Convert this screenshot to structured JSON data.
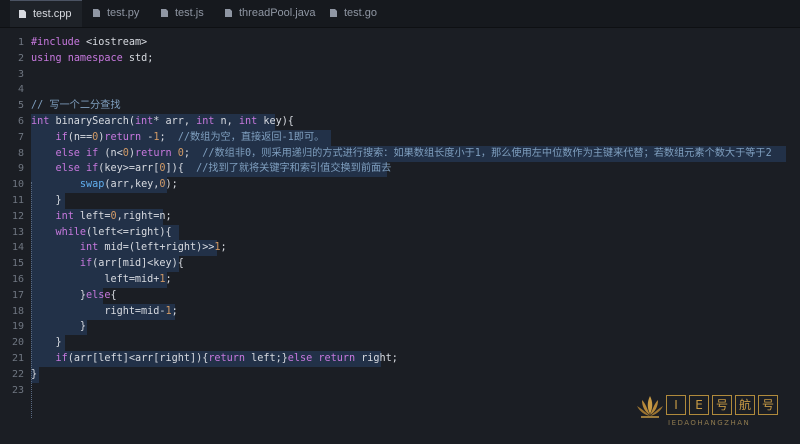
{
  "tabs": [
    {
      "label": "test.cpp",
      "active": true
    },
    {
      "label": "test.py",
      "active": false
    },
    {
      "label": "test.js",
      "active": false
    },
    {
      "label": "threadPool.java",
      "active": false
    },
    {
      "label": "test.go",
      "active": false
    }
  ],
  "colors": {
    "background": "#1b1e24",
    "keyword": "#c678dd",
    "number": "#d19a66",
    "comment": "#7f9fbf",
    "selection": "#223148"
  },
  "selected_lines": [
    6,
    22
  ],
  "code_lines": [
    {
      "n": "1",
      "tokens": [
        [
          "pp",
          "#include"
        ],
        [
          "pl",
          " <iostream>"
        ]
      ]
    },
    {
      "n": "2",
      "tokens": [
        [
          "kw",
          "using"
        ],
        [
          "pl",
          " "
        ],
        [
          "kw",
          "namespace"
        ],
        [
          "pl",
          " std;"
        ]
      ]
    },
    {
      "n": "3",
      "tokens": []
    },
    {
      "n": "4",
      "tokens": []
    },
    {
      "n": "5",
      "tokens": [
        [
          "cm",
          "// 写一个二分查找"
        ]
      ]
    },
    {
      "n": "6",
      "tokens": [
        [
          "ty",
          "int"
        ],
        [
          "pl",
          " binarySearch("
        ],
        [
          "ty",
          "int"
        ],
        [
          "pl",
          "* arr, "
        ],
        [
          "ty",
          "int"
        ],
        [
          "pl",
          " n, "
        ],
        [
          "ty",
          "int"
        ],
        [
          "pl",
          " key){"
        ]
      ]
    },
    {
      "n": "7",
      "tokens": [
        [
          "pl",
          "    "
        ],
        [
          "kw",
          "if"
        ],
        [
          "pl",
          "(n=="
        ],
        [
          "num",
          "0"
        ],
        [
          "pl",
          ")"
        ],
        [
          "kw",
          "return"
        ],
        [
          "pl",
          " -"
        ],
        [
          "num",
          "1"
        ],
        [
          "pl",
          ";  "
        ],
        [
          "cm",
          "//数组为空，直接返回-1即可。"
        ]
      ]
    },
    {
      "n": "8",
      "tokens": [
        [
          "pl",
          "    "
        ],
        [
          "kw",
          "else if"
        ],
        [
          "pl",
          " (n<"
        ],
        [
          "num",
          "0"
        ],
        [
          "pl",
          ")"
        ],
        [
          "kw",
          "return"
        ],
        [
          "pl",
          " "
        ],
        [
          "num",
          "0"
        ],
        [
          "pl",
          ";  "
        ],
        [
          "cm",
          "//数组非0，则采用递归的方式进行搜索：如果数组长度小于1，那么使用左中位数作为主键来代替；若数组元素个数大于等于2"
        ]
      ]
    },
    {
      "n": "9",
      "tokens": [
        [
          "pl",
          "    "
        ],
        [
          "kw",
          "else if"
        ],
        [
          "pl",
          "(key>=arr["
        ],
        [
          "num",
          "0"
        ],
        [
          "pl",
          "]){  "
        ],
        [
          "cm",
          "//找到了就将关键字和索引值交换到前面去"
        ]
      ]
    },
    {
      "n": "10",
      "tokens": [
        [
          "pl",
          "        "
        ],
        [
          "fn",
          "swap"
        ],
        [
          "pl",
          "(arr,key,"
        ],
        [
          "num",
          "0"
        ],
        [
          "pl",
          ");"
        ]
      ]
    },
    {
      "n": "11",
      "tokens": [
        [
          "pl",
          "    }"
        ]
      ]
    },
    {
      "n": "12",
      "tokens": [
        [
          "pl",
          "    "
        ],
        [
          "ty",
          "int"
        ],
        [
          "pl",
          " left="
        ],
        [
          "num",
          "0"
        ],
        [
          "pl",
          ",right=n;"
        ]
      ]
    },
    {
      "n": "13",
      "tokens": [
        [
          "pl",
          "    "
        ],
        [
          "kw",
          "while"
        ],
        [
          "pl",
          "(left<=right){"
        ]
      ]
    },
    {
      "n": "14",
      "tokens": [
        [
          "pl",
          "        "
        ],
        [
          "ty",
          "int"
        ],
        [
          "pl",
          " mid=(left+right)>>"
        ],
        [
          "num",
          "1"
        ],
        [
          "pl",
          ";"
        ]
      ]
    },
    {
      "n": "15",
      "tokens": [
        [
          "pl",
          "        "
        ],
        [
          "kw",
          "if"
        ],
        [
          "pl",
          "(arr[mid]<key){"
        ]
      ]
    },
    {
      "n": "16",
      "tokens": [
        [
          "pl",
          "            left=mid+"
        ],
        [
          "num",
          "1"
        ],
        [
          "pl",
          ";"
        ]
      ]
    },
    {
      "n": "17",
      "tokens": [
        [
          "pl",
          "        }"
        ],
        [
          "kw",
          "else"
        ],
        [
          "pl",
          "{"
        ]
      ]
    },
    {
      "n": "18",
      "tokens": [
        [
          "pl",
          "            right=mid-"
        ],
        [
          "num",
          "1"
        ],
        [
          "pl",
          ";"
        ]
      ]
    },
    {
      "n": "19",
      "tokens": [
        [
          "pl",
          "        }"
        ]
      ]
    },
    {
      "n": "20",
      "tokens": [
        [
          "pl",
          "    }"
        ]
      ]
    },
    {
      "n": "21",
      "tokens": [
        [
          "pl",
          "    "
        ],
        [
          "kw",
          "if"
        ],
        [
          "pl",
          "(arr[left]<arr[right]){"
        ],
        [
          "kw",
          "return"
        ],
        [
          "pl",
          " left;}"
        ],
        [
          "kw",
          "else"
        ],
        [
          "pl",
          " "
        ],
        [
          "kw",
          "return"
        ],
        [
          "pl",
          " right;"
        ]
      ]
    },
    {
      "n": "22",
      "tokens": [
        [
          "pl",
          "}"
        ]
      ]
    },
    {
      "n": "23",
      "tokens": []
    }
  ],
  "watermark": {
    "chars": [
      "I",
      "E",
      "号",
      "航",
      "号"
    ],
    "subtitle": "IEDAOHANGZHAN"
  }
}
